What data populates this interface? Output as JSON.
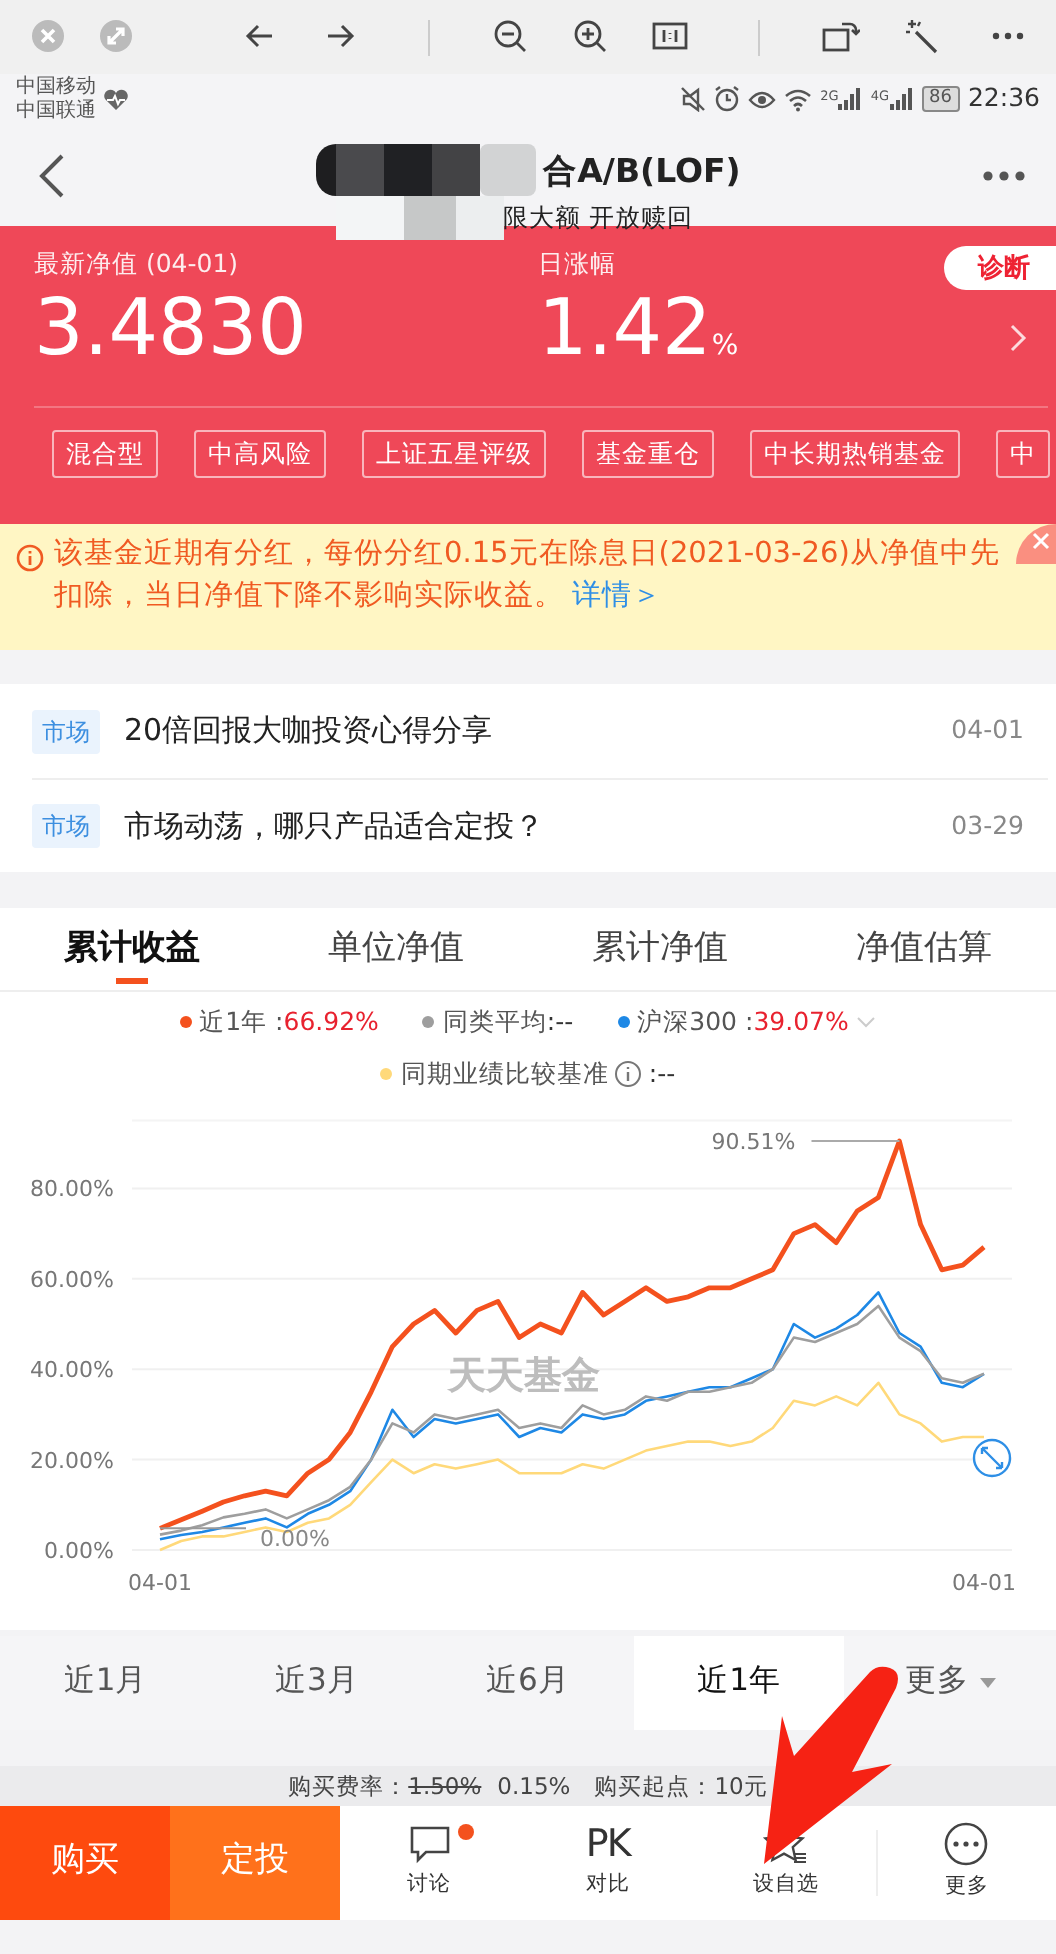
{
  "browser_toolbar": {
    "buttons": [
      {
        "kind": "close"
      },
      {
        "kind": "restore"
      },
      {
        "kind": "back"
      },
      {
        "kind": "forward"
      },
      {
        "kind": "sep"
      },
      {
        "kind": "zoom-out"
      },
      {
        "kind": "zoom-in"
      },
      {
        "kind": "actual-size"
      },
      {
        "kind": "sep"
      },
      {
        "kind": "rotate"
      },
      {
        "kind": "wand"
      },
      {
        "kind": "more"
      }
    ]
  },
  "status_bar": {
    "carriers": [
      "中国移动",
      "中国联通"
    ],
    "network_labels": [
      "2G",
      "4G"
    ],
    "battery": "86",
    "time": "22:36"
  },
  "nav": {
    "title": "合A/B(LOF)",
    "title_redacted": true,
    "subtitle": "限大额 开放赎回"
  },
  "header": {
    "nav_label": "最新净值 (04-01)",
    "nav_value": "3.4830",
    "change_label": "日涨幅",
    "change_value": "1.42",
    "change_unit": "%",
    "diagnose_button": "诊断",
    "tags": [
      "混合型",
      "中高风险",
      "上证五星评级",
      "基金重仓",
      "中长期热销基金",
      "中"
    ]
  },
  "notice": {
    "text": "该基金近期有分红，每份分红0.15元在除息日(2021-03-26)从净值中先扣除，当日净值下降不影响实际收益。",
    "link": "详情＞"
  },
  "news": [
    {
      "tag": "市场",
      "title": "20倍回报大咖投资心得分享",
      "date": "04-01"
    },
    {
      "tag": "市场",
      "title": "市场动荡，哪只产品适合定投？",
      "date": "03-29"
    }
  ],
  "chart_tabs": [
    {
      "label": "累计收益",
      "selected": true
    },
    {
      "label": "单位净值",
      "selected": false
    },
    {
      "label": "累计净值",
      "selected": false
    },
    {
      "label": "净值估算",
      "selected": false
    }
  ],
  "chart": {
    "legend": [
      {
        "colon": " :",
        "value": "66.92%"
      },
      {
        "value": " :--"
      },
      {
        "colon": " :",
        "value": "39.07%",
        "dropdown": true
      },
      {
        "value": " :--",
        "info": true
      }
    ],
    "watermark_text": "天天基金",
    "chart_data": {
      "type": "line",
      "categories": [
        "04-01",
        null,
        null,
        null,
        null,
        null,
        null,
        null,
        null,
        null,
        null,
        null,
        null,
        null,
        null,
        null,
        null,
        null,
        null,
        null,
        null,
        null,
        null,
        null,
        null,
        null,
        null,
        null,
        null,
        null,
        null,
        null,
        null,
        null,
        null,
        null,
        null,
        null,
        null,
        "04-01"
      ],
      "grid": true,
      "series": [
        {
          "name": "近1年",
          "color": "#f4511e",
          "values": [
            4.8,
            6.7,
            8.6,
            10.6,
            12,
            13,
            12,
            17,
            20,
            26,
            35,
            45,
            50,
            53,
            48,
            53,
            55,
            47,
            50,
            48,
            57,
            52,
            55,
            58,
            55,
            56,
            58,
            58,
            60,
            62,
            70,
            72,
            68,
            75,
            78,
            90.5,
            72,
            62,
            63,
            67
          ]
        },
        {
          "name": "同类平均",
          "color": "#9e9e9e",
          "values": [
            3.4,
            4.3,
            5.5,
            7.2,
            8,
            9,
            7,
            9,
            11,
            14,
            20,
            28,
            26,
            30,
            29,
            30,
            31,
            27,
            28,
            27,
            32,
            30,
            31,
            34,
            33,
            35,
            35,
            36,
            37,
            40,
            47,
            46,
            48,
            50,
            54,
            47,
            44,
            38,
            37,
            39
          ]
        },
        {
          "name": "沪深300",
          "color": "#1e88e5",
          "values": [
            2.4,
            3.3,
            4,
            5,
            6,
            7,
            5,
            8,
            10,
            13,
            20,
            31,
            25,
            29,
            28,
            29,
            30,
            25,
            27,
            26,
            30,
            29,
            30,
            33,
            34,
            35,
            36,
            36,
            38,
            40,
            50,
            47,
            49,
            52,
            57,
            48,
            45,
            37,
            36,
            39
          ]
        },
        {
          "name": "同期业绩比较基准",
          "color": "#ffd97a",
          "values": [
            0,
            2,
            3,
            3,
            4,
            5,
            4,
            6,
            7,
            10,
            15,
            20,
            17,
            19,
            18,
            19,
            20,
            17,
            17,
            17,
            19,
            18,
            20,
            22,
            23,
            24,
            24,
            23,
            24,
            27,
            33,
            32,
            34,
            32,
            37,
            30,
            28,
            24,
            25,
            25
          ]
        }
      ],
      "ylim": [
        0,
        95
      ],
      "yticks": [
        {
          "value": 0,
          "label": "0.00%"
        },
        {
          "value": 20,
          "label": "20.00%"
        },
        {
          "value": 40,
          "label": "40.00%"
        },
        {
          "value": 60,
          "label": "60.00%"
        },
        {
          "value": 80,
          "label": "80.00%"
        }
      ],
      "annotations": [
        "90.51%",
        "0.00%"
      ]
    }
  },
  "periods": [
    {
      "label": "近1月",
      "selected": false
    },
    {
      "label": "近3月",
      "selected": false
    },
    {
      "label": "近6月",
      "selected": false
    },
    {
      "label": "近1年",
      "selected": true
    },
    {
      "label": "更多",
      "selected": false,
      "dropdown": true
    }
  ],
  "fee": {
    "label": "购买费率：",
    "original": "1.50%",
    "rate": "0.15%",
    "minimum": "购买起点：10元"
  },
  "bottom_bar": {
    "buy": "购买",
    "plan": "定投",
    "actions": [
      {
        "kind": "comment",
        "label": "讨论",
        "dot": true
      },
      {
        "kind": "pk",
        "icon_text": "PK",
        "label": "对比"
      },
      {
        "kind": "star",
        "label": "设自选"
      },
      {
        "kind": "more",
        "label": "更多"
      }
    ]
  },
  "overlay": {
    "kind": "arrow"
  }
}
